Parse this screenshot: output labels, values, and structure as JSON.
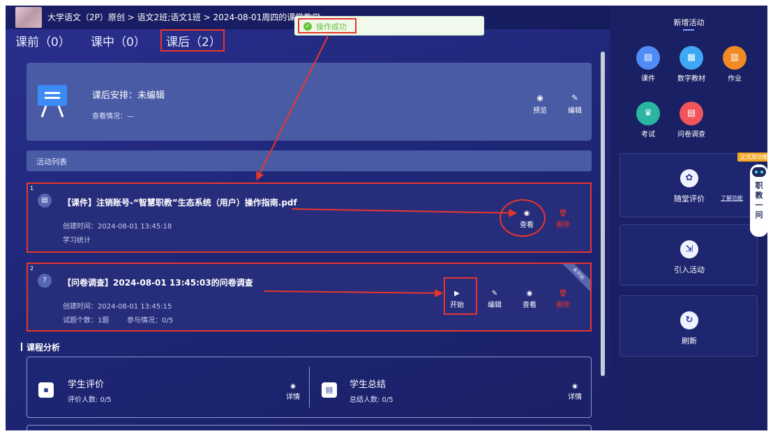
{
  "breadcrumb": "大学语文（2P）原创 > 语文2班;语文1班 > 2024-08-01周四的课堂教学",
  "toast": {
    "text": "操作成功"
  },
  "tabs": [
    {
      "label": "课前（0）"
    },
    {
      "label": "课中（0）"
    },
    {
      "label": "课后（2）"
    }
  ],
  "arrangement": {
    "title": "课后安排：未编辑",
    "status": "查看情况：—",
    "preview_label": "预览",
    "edit_label": "编辑"
  },
  "activity_list_label": "活动列表",
  "activities": [
    {
      "num": "1",
      "title": "【课件】注销账号-“智慧职教”生态系统（用户）操作指南.pdf",
      "created": "创建时间：2024-08-01 13:45:18",
      "extra": "学习统计",
      "actions": {
        "view": "查看",
        "delete": "删除"
      }
    },
    {
      "num": "2",
      "title": "【问卷调查】2024-08-01 13:45:03的问卷调查",
      "created": "创建时间：2024-08-01 13:45:15",
      "question_count": "试题个数：1题",
      "participation": "参与情况：0/5",
      "ribbon": "未开始",
      "actions": {
        "start": "开始",
        "edit": "编辑",
        "view": "查看",
        "delete": "删除"
      }
    }
  ],
  "analysis": {
    "title": "课程分析",
    "items": [
      {
        "title": "学生评价",
        "sub": "评价人数: 0/5",
        "detail": "详情"
      },
      {
        "title": "学生总结",
        "sub": "总结人数: 0/5",
        "detail": "详情"
      }
    ]
  },
  "right_panel": {
    "title": "新增活动",
    "tools": [
      {
        "label": "课件",
        "icon": "courseware-icon",
        "color": "#4f8cf7"
      },
      {
        "label": "数字教材",
        "icon": "textbook-icon",
        "color": "#3ea8f5"
      },
      {
        "label": "作业",
        "icon": "homework-icon",
        "color": "#f08a24"
      },
      {
        "label": "考试",
        "icon": "exam-icon",
        "color": "#2bb5a0"
      },
      {
        "label": "问卷调查",
        "icon": "survey-icon",
        "color": "#f0555b"
      }
    ],
    "eval_label": "随堂评价",
    "learn_more": "了解功能",
    "trial_badge": "正式版功能",
    "import_label": "引入活动",
    "refresh_label": "刷新",
    "assistant_text": "职教一问"
  }
}
